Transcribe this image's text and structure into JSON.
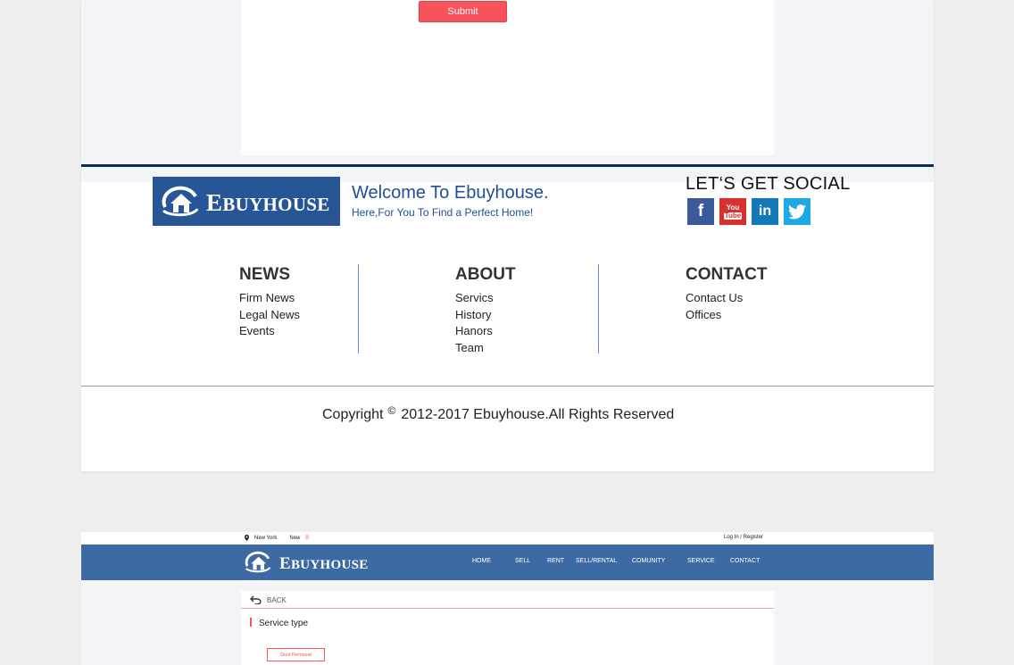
{
  "form": {
    "submit_label": "Submit"
  },
  "footer": {
    "brand": {
      "first_letter": "E",
      "rest": "BUYHOUSE"
    },
    "welcome_title": "Welcome To Ebuyhouse.",
    "welcome_subtitle": "Here,For You To Find a Perfect Home!",
    "social_title": "LET‘S GET SOCIAL",
    "social_icons": [
      {
        "name": "facebook-icon",
        "glyph": "f",
        "color": "#3b5a9a"
      },
      {
        "name": "youtube-icon",
        "glyph_top": "You",
        "glyph_bottom": "Tube",
        "color": "#d5322f"
      },
      {
        "name": "linkedin-icon",
        "glyph": "in",
        "color": "#1479b8"
      },
      {
        "name": "twitter-icon",
        "color": "#1ea8e6"
      }
    ],
    "columns": {
      "news": {
        "title": "NEWS",
        "items": [
          "Firm News",
          "Legal News",
          "Events"
        ]
      },
      "about": {
        "title": "ABOUT",
        "items": [
          "Servics",
          "History",
          "Hanors",
          "Team"
        ]
      },
      "contact": {
        "title": "CONTACT",
        "items": [
          "Contact Us",
          "Offices"
        ]
      }
    },
    "copyright": {
      "prefix": "Copyright",
      "symbol": "©",
      "text": "2012-2017 Ebuyhouse.All Rights Reserved"
    }
  },
  "page2": {
    "topbar": {
      "location": "New York",
      "new_label": "New",
      "new_count": "0",
      "login": "Log In / Register"
    },
    "nav": [
      "HOME",
      "SELL",
      "RENT",
      "SELL/RENTAL",
      "COMUNITY",
      "SERVICE",
      "CONTACT"
    ],
    "back_label": "BACK",
    "service_title": "Service type",
    "service_tag": "Dust Removal"
  },
  "colors": {
    "accent_red": "#f8525b",
    "navy_rule": "#0f2a5e",
    "brand_blue": "#275596",
    "nav_blue": "#3e6aa4"
  }
}
